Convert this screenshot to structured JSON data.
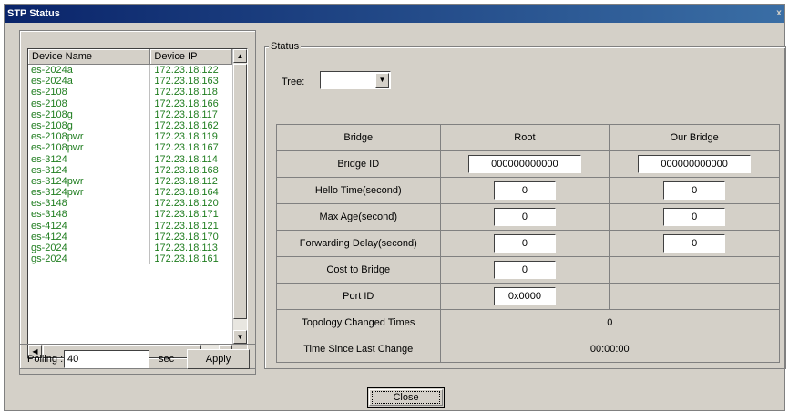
{
  "window": {
    "title": "STP Status",
    "close_glyph": "x"
  },
  "device_list": {
    "columns": [
      "Device Name",
      "Device IP"
    ],
    "rows": [
      {
        "name": "es-2024a",
        "ip": "172.23.18.122"
      },
      {
        "name": "es-2024a",
        "ip": "172.23.18.163"
      },
      {
        "name": "es-2108",
        "ip": "172.23.18.118"
      },
      {
        "name": "es-2108",
        "ip": "172.23.18.166"
      },
      {
        "name": "es-2108g",
        "ip": "172.23.18.117"
      },
      {
        "name": "es-2108g",
        "ip": "172.23.18.162"
      },
      {
        "name": "es-2108pwr",
        "ip": "172.23.18.119"
      },
      {
        "name": "es-2108pwr",
        "ip": "172.23.18.167"
      },
      {
        "name": "es-3124",
        "ip": "172.23.18.114"
      },
      {
        "name": "es-3124",
        "ip": "172.23.18.168"
      },
      {
        "name": "es-3124pwr",
        "ip": "172.23.18.112"
      },
      {
        "name": "es-3124pwr",
        "ip": "172.23.18.164"
      },
      {
        "name": "es-3148",
        "ip": "172.23.18.120"
      },
      {
        "name": "es-3148",
        "ip": "172.23.18.171"
      },
      {
        "name": "es-4124",
        "ip": "172.23.18.121"
      },
      {
        "name": "es-4124",
        "ip": "172.23.18.170"
      },
      {
        "name": "gs-2024",
        "ip": "172.23.18.113"
      },
      {
        "name": "gs-2024",
        "ip": "172.23.18.161"
      }
    ],
    "row_text_color": "#1f7d1f"
  },
  "polling": {
    "label": "Polling :",
    "value": "40",
    "unit": "sec",
    "apply_label": "Apply"
  },
  "status": {
    "group_label": "Status",
    "tree_label": "Tree:",
    "tree_value": "",
    "table": {
      "headers": [
        "Bridge",
        "Root",
        "Our Bridge"
      ],
      "bridge_id": {
        "label": "Bridge ID",
        "root": "000000000000",
        "our": "000000000000"
      },
      "hello_time": {
        "label": "Hello Time(second)",
        "root": "0",
        "our": "0"
      },
      "max_age": {
        "label": "Max Age(second)",
        "root": "0",
        "our": "0"
      },
      "forwarding_delay": {
        "label": "Forwarding Delay(second)",
        "root": "0",
        "our": "0"
      },
      "cost_to_bridge": {
        "label": "Cost to Bridge",
        "root": "0"
      },
      "port_id": {
        "label": "Port ID",
        "root": "0x0000"
      },
      "topology_changed": {
        "label": "Topology Changed Times",
        "value": "0"
      },
      "time_since_change": {
        "label": "Time Since Last Change",
        "value": "00:00:00"
      }
    }
  },
  "close_label": "Close",
  "colors": {
    "title_bar": "#0a246a",
    "window_bg": "#d4d0c8"
  }
}
